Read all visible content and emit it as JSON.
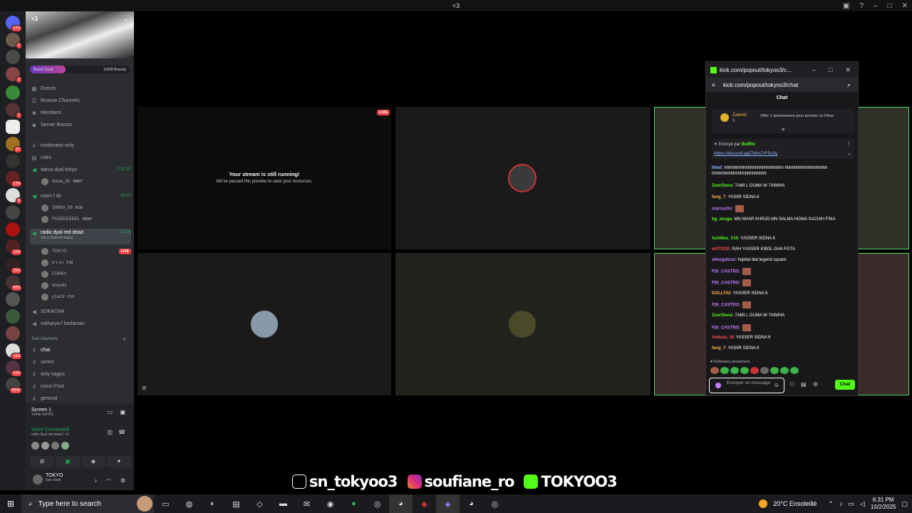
{
  "window": {
    "title": "<3"
  },
  "discord": {
    "server_name": "<3",
    "boost": {
      "label": "Boost Goal",
      "count": "10/28 Boosts",
      "progress": 0.357
    },
    "menu": [
      "Events",
      "Browse Channels",
      "Members",
      "Server Boosts"
    ],
    "channels": [
      {
        "name": "moderator-only",
        "type": "text"
      },
      {
        "name": "rules",
        "type": "text"
      },
      {
        "name": "darsa dyal tokyo",
        "type": "voice",
        "time": "2:31:57"
      },
      {
        "name": "room f ds",
        "type": "voice",
        "time": "28:27"
      },
      {
        "name": "radio dyal red dead",
        "type": "voice",
        "time": "22:44",
        "status": "Set a channel status"
      },
      {
        "name": "3OKACHA",
        "type": "voice"
      },
      {
        "name": "mkharya f barlaman",
        "type": "voice"
      }
    ],
    "darsa_users": [
      {
        "name": "Astaa_92",
        "tag": "BBNY"
      }
    ],
    "room_users": [
      {
        "name": "SIMBA_09",
        "tag": "FCB"
      },
      {
        "name": "FADEEEEEEL",
        "tag": "BBNY"
      }
    ],
    "radio_users": [
      {
        "name": "TOKYO",
        "live": "LIVE"
      },
      {
        "name": "e v a r",
        "tag": "F10"
      },
      {
        "name": "FURRY"
      },
      {
        "name": "smooks"
      },
      {
        "name": "y1as3r",
        "tag": "F10"
      }
    ],
    "text_section": "Text channels",
    "text_channels": [
      "chat",
      "series",
      "only-vagos",
      "moul-l7out",
      "general"
    ],
    "server_badges": [
      "479",
      "2",
      "3",
      "1",
      "37",
      "139",
      "4",
      "326",
      "354",
      "665",
      "329",
      "434",
      "NEW"
    ],
    "screen": {
      "title": "Screen 1",
      "sub": "1440p 60FPS"
    },
    "voice": {
      "label": "Voice Connected",
      "channel": "radio dyal red dead / <3"
    },
    "user": {
      "name": "TOKYO",
      "status": "ban sheik"
    }
  },
  "stream": {
    "paused_title": "Your stream is still running!",
    "paused_sub": "We've paused this preview to save your resources.",
    "live_label": "LIVE"
  },
  "kick": {
    "window_title": "kick.com/popout/tokyoo3/c...",
    "url": "kick.com/popout/tokyoo3/chat",
    "chat_title": "Chat",
    "pinned_user": "Zakmb",
    "pinned_count": "5",
    "pinned_text": "Offrir 1 abonnement pour prendre la 24me",
    "sent_by_label": "Envoyé par",
    "bot_name": "BotRix",
    "bot_link": "https://discord.gg/7Mm7rF5s3y",
    "messages": [
      {
        "user": "l9daf",
        "color": "#8ab4ff",
        "text": "hhhhhhhhhhhhhhhhhhhhhhhhh hhhhhhhhhhhhhhhhhh hhhhhhhhhhhhhhhhhhhhhhh"
      },
      {
        "user": "ZoorOooo",
        "color": "#53fc18",
        "text": "7AMI L OUMA W 7AWIHA"
      },
      {
        "user": "fang_7",
        "color": "#ffb347",
        "text": "YASIIR SIDNA 6"
      },
      {
        "user": "marcuzXx",
        "color": "#c77dff",
        "text": ""
      },
      {
        "user": "bg_zouga",
        "color": "#53fc18",
        "text": "MN NHAR KHRJO MN SALMA HOWA SACHIH FINA"
      },
      {
        "user": "Achilles_V10",
        "color": "#53fc18",
        "text": "YASSER SIDNA 6"
      },
      {
        "user": "witTXOO",
        "color": "#ff4d4d",
        "text": "RAH YASSER KI9OL GHA FGTA"
      },
      {
        "user": "altecgatouz",
        "color": "#c77dff",
        "text": "hopital dial legend square"
      },
      {
        "user": "FDI_CASTRO",
        "color": "#c77dff",
        "text": ""
      },
      {
        "user": "FDI_CASTRO",
        "color": "#c77dff",
        "text": ""
      },
      {
        "user": "DOLLY02",
        "color": "#ffb347",
        "text": "YASSER SIDNA 6"
      },
      {
        "user": "FDI_CASTRO",
        "color": "#c77dff",
        "text": ""
      },
      {
        "user": "ZoorOooo",
        "color": "#53fc18",
        "text": "7AMI L OUMA W 7AWIHA"
      },
      {
        "user": "FDI_CASTRO",
        "color": "#c77dff",
        "text": ""
      },
      {
        "user": "Amtaas_W",
        "color": "#ff4d4d",
        "text": "YASSER SIDNA 6"
      },
      {
        "user": "fang_7",
        "color": "#ffb347",
        "text": "YASIIR SIDNA 6"
      }
    ],
    "followers_only": "Followers seulement",
    "input_placeholder": "Envoyer un message",
    "chat_button": "Chat"
  },
  "overlay": {
    "tiktok": "sn_tokyoo3",
    "instagram": "soufiane_ro",
    "kick": "TOKYOO3"
  },
  "taskbar": {
    "search_placeholder": "Type here to search",
    "weather": "20°C Ensoleillé",
    "time": "6:31 PM",
    "date": "10/2/2025"
  }
}
